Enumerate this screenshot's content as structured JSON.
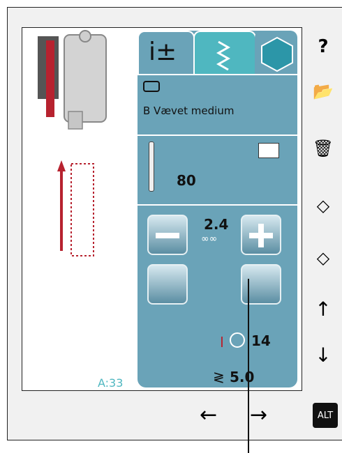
{
  "fabric": {
    "name": "B Vævet medium"
  },
  "needle": {
    "size": "80"
  },
  "stitch_length": {
    "value": "2.4"
  },
  "buttonhole": {
    "size": "14"
  },
  "stitch_width": {
    "value": "5.0"
  },
  "stitch_number": "A:33",
  "alt_label": "ALT",
  "help_label": "?"
}
